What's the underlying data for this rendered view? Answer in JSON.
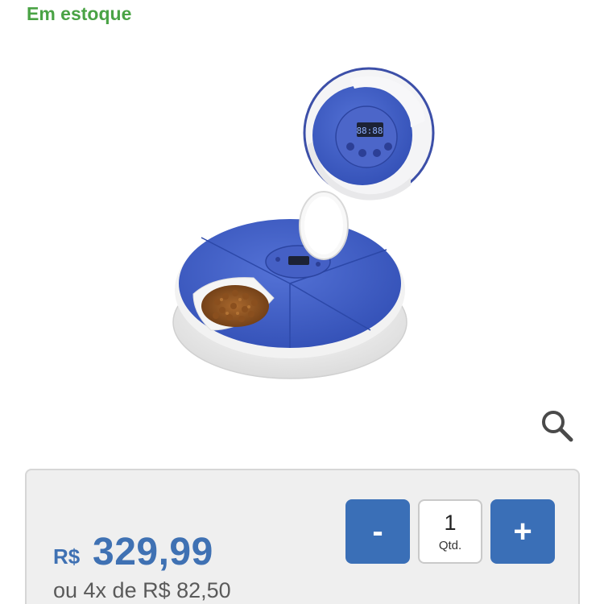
{
  "stock": {
    "status": "Em estoque"
  },
  "product": {
    "image_alt": "automatic pet feeder",
    "timer_display": "88:88"
  },
  "zoom": {
    "icon": "magnifier-icon"
  },
  "pricing": {
    "currency": "R$",
    "price": "329,99",
    "installments": "ou 4x de R$ 82,50"
  },
  "quantity": {
    "decrement_label": "-",
    "value": "1",
    "label": "Qtd.",
    "increment_label": "+"
  },
  "colors": {
    "stock_green": "#4aa345",
    "price_blue": "#3f71b3",
    "button_blue": "#3a6fb7",
    "feeder_blue": "#3d5fc4"
  }
}
